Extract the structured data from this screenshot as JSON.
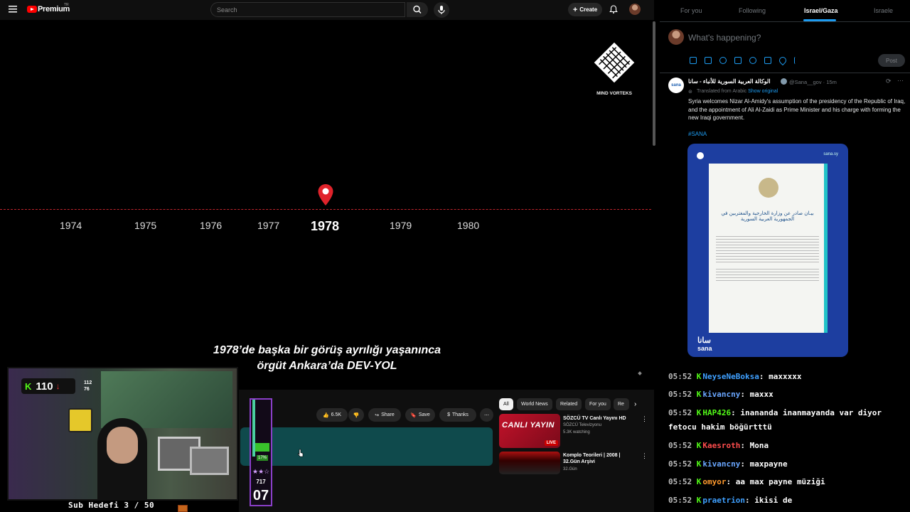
{
  "youtube": {
    "brand": "Premium",
    "brand_sup": "TR",
    "search_placeholder": "Search",
    "create_label": "Create",
    "channel_logo_text": "MIND VORTEKS",
    "timeline_years": [
      "1974",
      "1975",
      "1976",
      "1977",
      "1978",
      "1979",
      "1980"
    ],
    "active_year": "1978",
    "subtitle_line1": "1978’de başka bir görüş ayrılığı yaşanınca",
    "subtitle_line2": "örgüt Ankara’da DEV-YOL",
    "like_count": "6.5K",
    "share_label": "Share",
    "save_label": "Save",
    "thanks_label": "Thanks",
    "chips": [
      "All",
      "World News",
      "Related",
      "For you",
      "Re"
    ],
    "recommendations": [
      {
        "title": "SÖZCÜ TV Canlı Yayını HD",
        "channel": "SÖZCÜ Televizyonu",
        "meta": "5.3K watching",
        "thumb_text": "CANLI YAYIN",
        "thumb_badge": "LIVE"
      },
      {
        "title": "Komplo Teorileri | 2008 | 32.Gün Arşivi",
        "channel": "",
        "meta": "32.Gün",
        "thumb_text": "",
        "thumb_badge": ""
      }
    ]
  },
  "stream": {
    "kick_count": "110",
    "stat_top": "112",
    "stat_bottom": "76",
    "sub_goal": "Sub Hedefi 3 / 50",
    "meter_percent_label": "17%",
    "meter_fill": 0.17,
    "meter_value": "717",
    "meter_big": "07"
  },
  "twitter": {
    "tabs": [
      "For you",
      "Following",
      "Israel/Gaza",
      "Israele"
    ],
    "selected_tab": "Israel/Gaza",
    "compose_placeholder": "What's happening?",
    "post_label": "Post",
    "tweet": {
      "name": "الوكالة العربية السورية للأنباء - سانا",
      "handle": "@Sana__gov · 15m",
      "translated": "Translated from Arabic",
      "show_original": "Show original",
      "body": "Syria welcomes Nizar Al-Amidy's assumption of the presidency of the Republic of Iraq, and the appointment of Ali Al-Zaidi as Prime Minister and his charge with forming the new Iraqi government.",
      "hashtag": "#SANA",
      "card_site": "sana.sy",
      "card_heading": "بيـان صادر عن وزارة الخارجية والمغتربين في الجمهورية العربية السورية",
      "card_logo": "سانا",
      "card_logo_latin": "sana"
    }
  },
  "chat": [
    {
      "time": "05:52",
      "user": "NeyseNeBoksa",
      "color": "#3fa0ff",
      "msg": "maxxxxx"
    },
    {
      "time": "05:52",
      "user": "kivancny",
      "color": "#6aa7ff",
      "msg": "maxxx"
    },
    {
      "time": "05:52",
      "user": "HAP426",
      "color": "#53fc18",
      "msg": "inananda inanmayanda var diyor fetocu hakim böğürtttü"
    },
    {
      "time": "05:52",
      "user": "Kaesroth",
      "color": "#ff4d4d",
      "msg": "Mona"
    },
    {
      "time": "05:52",
      "user": "kivancny",
      "color": "#6aa7ff",
      "msg": "maxpayne"
    },
    {
      "time": "05:52",
      "user": "omyor",
      "color": "#ff9a2e",
      "msg": "aa max payne müziği"
    },
    {
      "time": "05:52",
      "user": "praetrion",
      "color": "#3fa0ff",
      "msg": "ikisi de"
    }
  ]
}
